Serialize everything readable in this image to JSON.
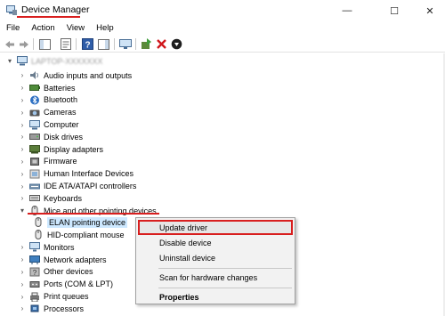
{
  "window": {
    "title": "Device Manager",
    "accent_red": "#d81e1e",
    "selection_color": "#cde8ff",
    "controls": {
      "minimize": "—",
      "maximize": "☐",
      "close": "✕"
    }
  },
  "menu": [
    "File",
    "Action",
    "View",
    "Help"
  ],
  "toolbar": {
    "buttons": [
      "back-arrow-icon",
      "forward-arrow-icon",
      "show-hide-tree-icon",
      "properties-icon",
      "help-icon",
      "action-pane-icon",
      "monitor-icon",
      "add-driver-icon",
      "uninstall-x-icon",
      "download-driver-icon"
    ]
  },
  "tree": {
    "root": {
      "label": "LAPTOP-XXXXXXX"
    },
    "categories": [
      {
        "label": "Audio inputs and outputs",
        "icon": "speaker-icon"
      },
      {
        "label": "Batteries",
        "icon": "battery-icon"
      },
      {
        "label": "Bluetooth",
        "icon": "bluetooth-icon"
      },
      {
        "label": "Cameras",
        "icon": "camera-icon"
      },
      {
        "label": "Computer",
        "icon": "computer-icon"
      },
      {
        "label": "Disk drives",
        "icon": "disk-icon"
      },
      {
        "label": "Display adapters",
        "icon": "display-icon"
      },
      {
        "label": "Firmware",
        "icon": "firmware-icon"
      },
      {
        "label": "Human Interface Devices",
        "icon": "hid-icon"
      },
      {
        "label": "IDE ATA/ATAPI controllers",
        "icon": "ide-icon"
      },
      {
        "label": "Keyboards",
        "icon": "keyboard-icon"
      },
      {
        "label": "Mice and other pointing devices",
        "icon": "mouse-icon"
      }
    ],
    "mice_children": [
      {
        "label": "ELAN pointing device",
        "selected": true
      },
      {
        "label": "HID-compliant mouse",
        "selected": false
      }
    ],
    "after": [
      {
        "label": "Monitors",
        "icon": "monitor-icon"
      },
      {
        "label": "Network adapters",
        "icon": "network-icon"
      },
      {
        "label": "Other devices",
        "icon": "other-icon"
      },
      {
        "label": "Ports (COM & LPT)",
        "icon": "port-icon"
      },
      {
        "label": "Print queues",
        "icon": "printer-icon"
      },
      {
        "label": "Processors",
        "icon": "processor-icon"
      }
    ]
  },
  "context_menu": {
    "items": [
      "Update driver",
      "Disable device",
      "Uninstall device",
      "Scan for hardware changes",
      "Properties"
    ]
  }
}
